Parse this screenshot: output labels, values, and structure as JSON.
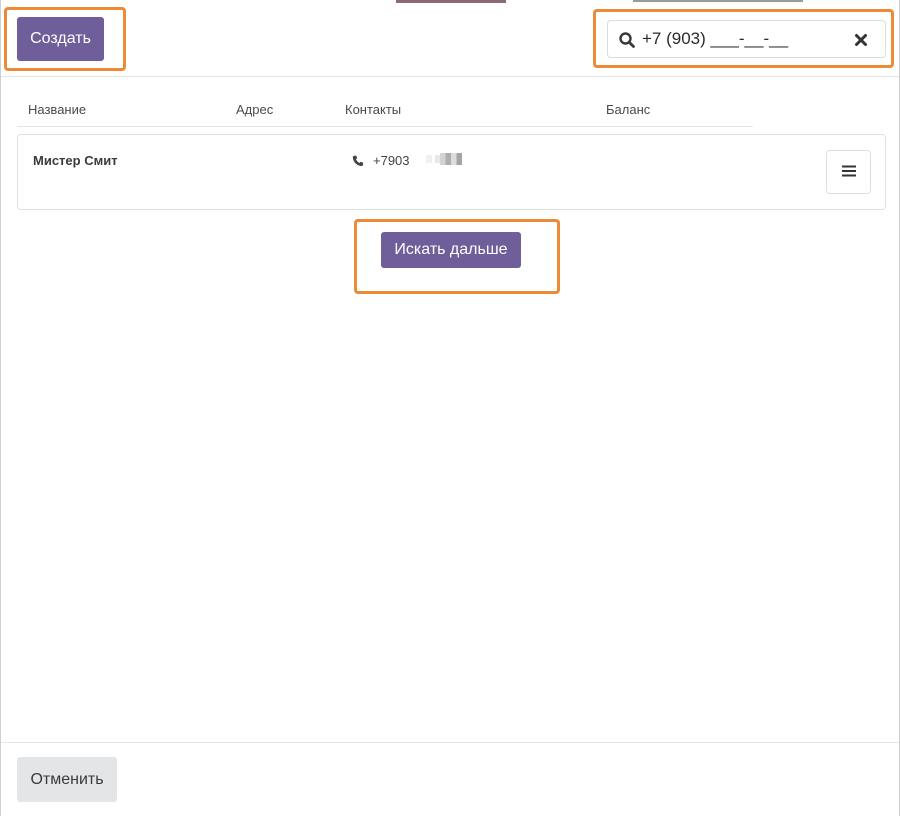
{
  "header": {
    "create_label": "Создать",
    "search": {
      "value": "+7 (903) ___-__-__",
      "icon": "search-icon",
      "clear_icon": "close-icon"
    }
  },
  "table": {
    "columns": [
      "Название",
      "Адрес",
      "Контакты",
      "Баланс"
    ],
    "rows": [
      {
        "name": "Мистер Смит",
        "address": "",
        "phone": "+7903",
        "balance": "",
        "menu_icon": "hamburger-menu-icon"
      }
    ]
  },
  "search_more_label": "Искать дальше",
  "footer": {
    "cancel_label": "Отменить"
  },
  "colors": {
    "primary": "#6f5e9a",
    "highlight": "#ec8a35",
    "secondary_button": "#e4e5e7"
  }
}
